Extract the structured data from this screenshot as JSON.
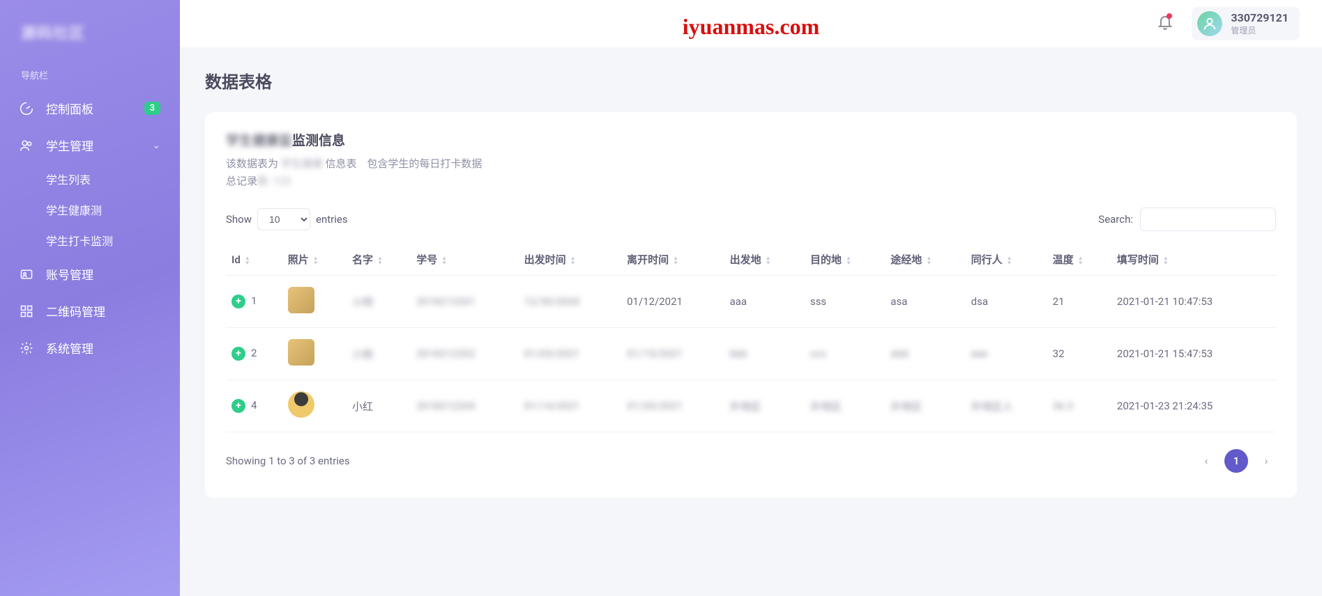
{
  "watermark": "iyuanmas.com",
  "brand": "源码社区",
  "nav_label": "导航栏",
  "sidebar": {
    "items": [
      {
        "label": "控制面板",
        "badge": "3"
      },
      {
        "label": "学生管理"
      },
      {
        "label": "账号管理"
      },
      {
        "label": "二维码管理"
      },
      {
        "label": "系统管理"
      }
    ],
    "sub": [
      {
        "label": "学生列表"
      },
      {
        "label": "学生健康测"
      },
      {
        "label": "学生打卡监测"
      }
    ]
  },
  "topbar": {
    "user_id": "330729121",
    "user_role": "管理员"
  },
  "page_title": "数据表格",
  "card": {
    "title": "监测信息",
    "subtitle_prefix": "该数据表为",
    "subtitle_mid": "信息表",
    "subtitle_suffix": "包含学生的每日打卡数据",
    "subtitle2": "总记录"
  },
  "table_controls": {
    "show_label": "Show",
    "entries_value": "10",
    "entries_label": "entries",
    "search_label": "Search:"
  },
  "table": {
    "headers": [
      "Id",
      "照片",
      "名字",
      "学号",
      "出发时间",
      "离开时间",
      "出发地",
      "目的地",
      "途经地",
      "同行人",
      "温度",
      "填写时间"
    ],
    "rows": [
      {
        "id": "1",
        "name": "小明",
        "sno": "2018212201",
        "depart": "12/30/2020",
        "leave": "01/12/2021",
        "from": "aaa",
        "to": "sss",
        "via": "asa",
        "with": "dsa",
        "temp": "21",
        "time": "2021-01-21 10:47:53"
      },
      {
        "id": "2",
        "name": "小刚",
        "sno": "2018212202",
        "depart": "01/05/2021",
        "leave": "01/15/2021",
        "from": "bbb",
        "to": "ccc",
        "via": "ddd",
        "with": "eee",
        "temp": "32",
        "time": "2021-01-21 15:47:53"
      },
      {
        "id": "4",
        "name": "小红",
        "sno": "2018212204",
        "depart": "01/14/2021",
        "leave": "01/20/2021",
        "from": "外地区",
        "to": "外地区",
        "via": "外地区",
        "with": "外地区人",
        "temp": "36.5",
        "time": "2021-01-23 21:24:35"
      }
    ]
  },
  "footer": {
    "info": "Showing 1 to 3 of 3 entries",
    "page": "1"
  }
}
